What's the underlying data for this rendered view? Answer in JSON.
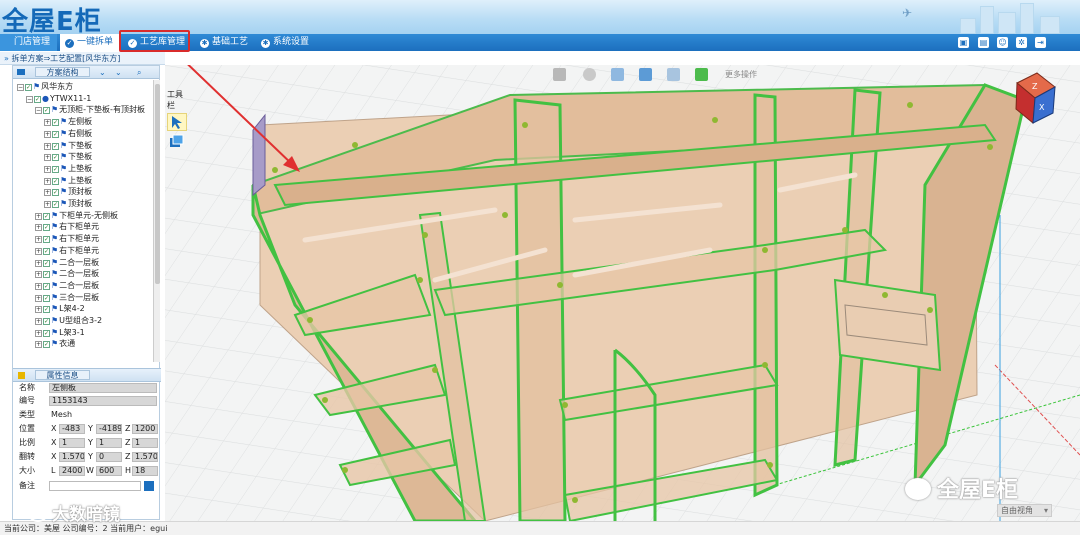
{
  "header": {
    "logo_text": "全屋E柜"
  },
  "nav": {
    "store": "门店管理",
    "split": "一键拆单",
    "craft": "工艺库管理",
    "base": "基础工艺",
    "settings": "系统设置"
  },
  "breadcrumb": "拆单方案⇒工艺配置[风华东方]",
  "tree_panel": {
    "title": "方案结构"
  },
  "tree": [
    {
      "label": "风华东方",
      "level": 0,
      "expander": "−"
    },
    {
      "label": "YTWX11-1",
      "level": 1,
      "expander": "−"
    },
    {
      "label": "无顶柜-下垫板-有顶封板",
      "level": 2,
      "expander": "−"
    },
    {
      "label": "左侧板",
      "level": 3,
      "expander": "+"
    },
    {
      "label": "右侧板",
      "level": 3,
      "expander": "+"
    },
    {
      "label": "下垫板",
      "level": 3,
      "expander": "+"
    },
    {
      "label": "下垫板",
      "level": 3,
      "expander": "+"
    },
    {
      "label": "上垫板",
      "level": 3,
      "expander": "+"
    },
    {
      "label": "上垫板",
      "level": 3,
      "expander": "+"
    },
    {
      "label": "顶封板",
      "level": 3,
      "expander": "+"
    },
    {
      "label": "顶封板",
      "level": 3,
      "expander": "+"
    },
    {
      "label": "下柜单元-无侧板",
      "level": 2,
      "expander": "+"
    },
    {
      "label": "右下柜单元",
      "level": 2,
      "expander": "+"
    },
    {
      "label": "右下柜单元",
      "level": 2,
      "expander": "+"
    },
    {
      "label": "右下柜单元",
      "level": 2,
      "expander": "+"
    },
    {
      "label": "二合一层板",
      "level": 2,
      "expander": "+"
    },
    {
      "label": "二合一层板",
      "level": 2,
      "expander": "+"
    },
    {
      "label": "二合一层板",
      "level": 2,
      "expander": "+"
    },
    {
      "label": "三合一层板",
      "level": 2,
      "expander": "+"
    },
    {
      "label": "L架4-2",
      "level": 2,
      "expander": "+"
    },
    {
      "label": "U型组合3-2",
      "level": 2,
      "expander": "+"
    },
    {
      "label": "L架3-1",
      "level": 2,
      "expander": "+"
    },
    {
      "label": "衣通",
      "level": 2,
      "expander": "+"
    }
  ],
  "properties": {
    "title": "属性信息",
    "name_label": "名称",
    "name_value": "左侧板",
    "id_label": "编号",
    "id_value": "1153143",
    "type_label": "类型",
    "type_value": "Mesh",
    "pos_label": "位置",
    "pos_x": "-483",
    "pos_y": "-4189",
    "pos_z": "1200",
    "scale_label": "比例",
    "scale_x": "1",
    "scale_y": "1",
    "scale_z": "1",
    "rot_label": "翻转",
    "rot_x": "1.570",
    "rot_y": "0",
    "rot_z": "1.570",
    "size_label": "大小",
    "size_l": "2400",
    "size_w": "600",
    "size_h": "18",
    "note_label": "备注",
    "axis_x": "X",
    "axis_y": "Y",
    "axis_z": "Z",
    "axis_l": "L",
    "axis_w": "W",
    "axis_h": "H"
  },
  "viewport": {
    "toolbox_label": "工具栏",
    "more_ops": "更多操作",
    "view_select": "自由视角"
  },
  "status": {
    "text": "当前公司：美屋  公司编号：2  当前用户：egui"
  },
  "watermarks": {
    "right": "全屋E柜",
    "left": "大数暗镜"
  },
  "colors": {
    "nav_blue": "#1c6fbe",
    "edge_green": "#3bc43b",
    "panel_fill": "#e8c6a6",
    "highlight_red": "#d92b2b"
  }
}
